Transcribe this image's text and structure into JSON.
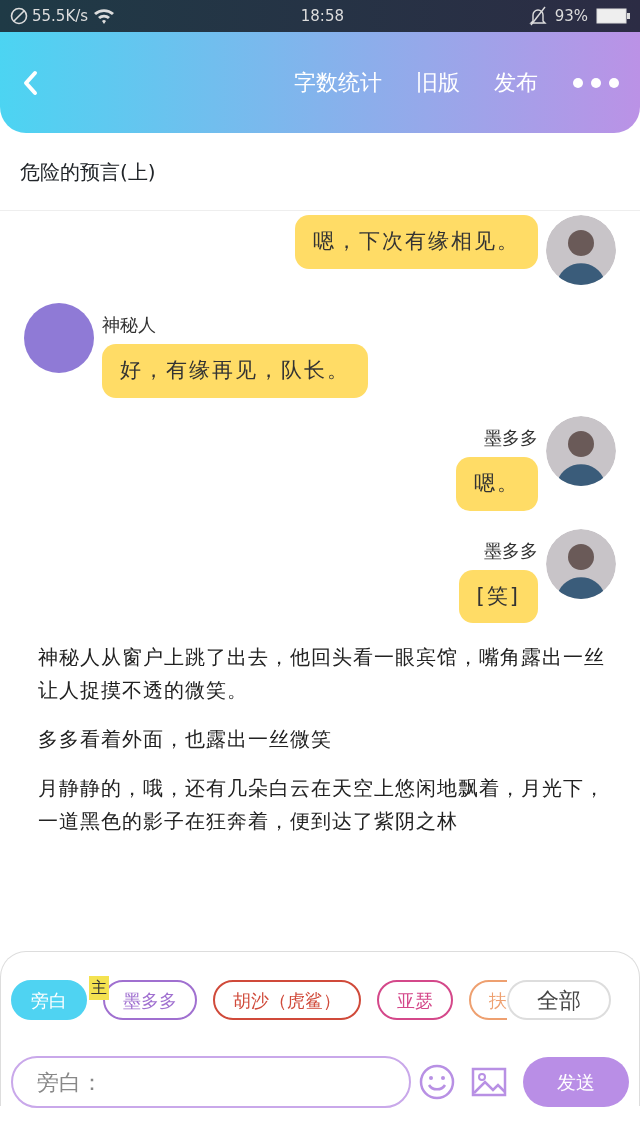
{
  "status_bar": {
    "speed": "55.5K/s",
    "time": "18:58",
    "battery": "93%"
  },
  "header": {
    "actions": [
      "字数统计",
      "旧版",
      "发布"
    ]
  },
  "chapter_title": "危险的预言(上)",
  "messages": [
    {
      "kind": "right",
      "text": "嗯，下次有缘相见。"
    },
    {
      "kind": "left",
      "name": "神秘人",
      "text": "好，有缘再见，队长。"
    },
    {
      "kind": "right",
      "name": "墨多多",
      "text": "嗯。"
    },
    {
      "kind": "right",
      "name": "墨多多",
      "text": "[笑]"
    },
    {
      "kind": "narration",
      "text": "神秘人从窗户上跳了出去，他回头看一眼宾馆，嘴角露出一丝让人捉摸不透的微笑。"
    },
    {
      "kind": "narration",
      "text": "多多看着外面，也露出一丝微笑"
    },
    {
      "kind": "narration",
      "text": "月静静的，哦，还有几朵白云在天空上悠闲地飘着，月光下，一道黑色的影子在狂奔着，便到达了紫阴之林"
    }
  ],
  "characters": [
    {
      "label": "旁白",
      "selected": true,
      "color": "#4fd3f2"
    },
    {
      "label": "墨多多",
      "selected": false,
      "color": "#a070d0",
      "badge": "主"
    },
    {
      "label": "胡沙（虎鲨）",
      "selected": false,
      "color": "#d04a3a"
    },
    {
      "label": "亚瑟",
      "selected": false,
      "color": "#d4488a"
    },
    {
      "label": "扶",
      "selected": false,
      "color": "#eea070"
    }
  ],
  "all_button": "全部",
  "input": {
    "placeholder": "旁白："
  },
  "send_button": "发送"
}
